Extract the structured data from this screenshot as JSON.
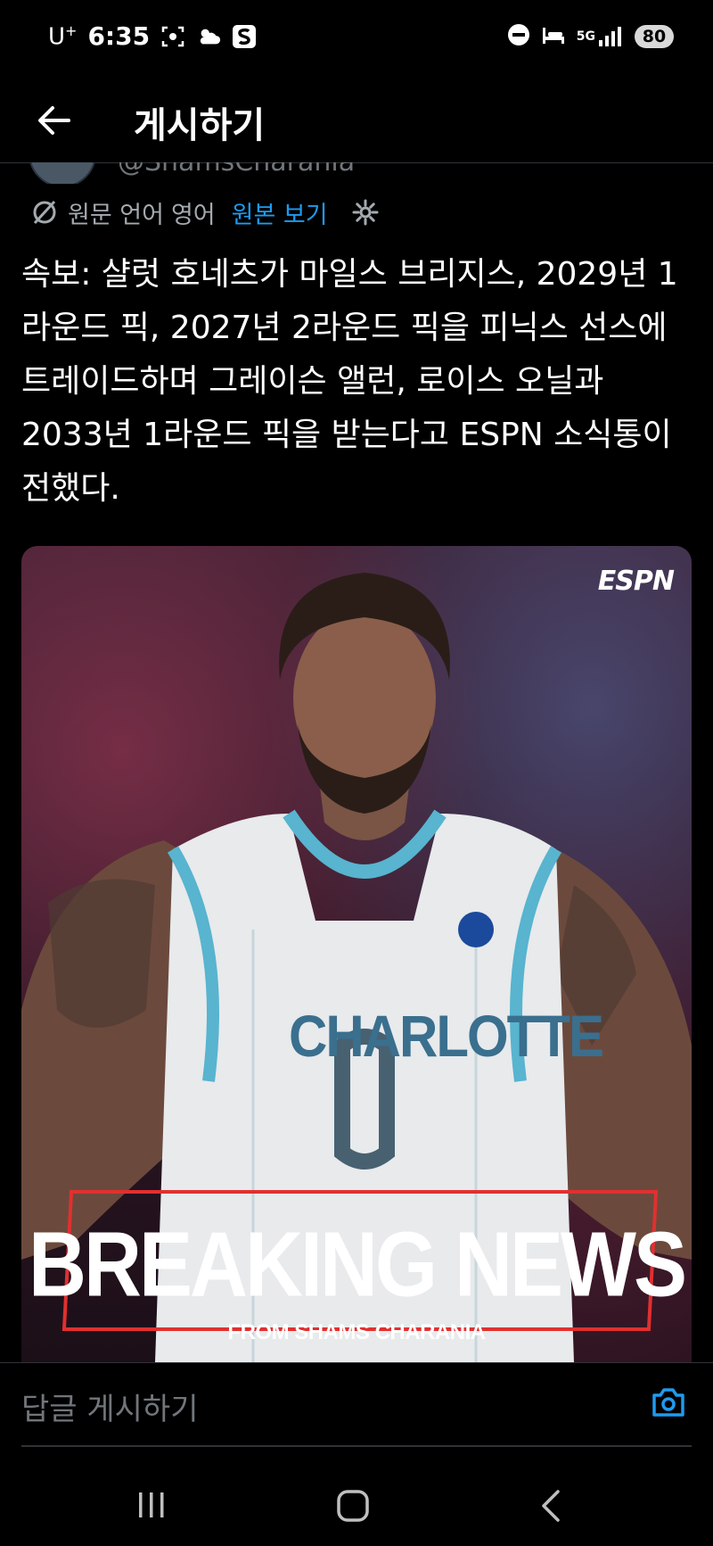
{
  "status_bar": {
    "carrier": "U",
    "carrier_sup": "+",
    "time": "6:35",
    "network": "5G",
    "battery": "80"
  },
  "header": {
    "title": "게시하기"
  },
  "tweet": {
    "handle": "@ShamsCharania",
    "translation_label": "원문 언어",
    "translation_lang": "영어",
    "show_original": "원본 보기",
    "text": "속보: 샬럿 호네츠가 마일스 브리지스, 2029년 1라운드 픽, 2027년 2라운드 픽을 피닉스 선스에 트레이드하며 그레이슨 앨런, 로이스 오닐과 2033년 1라운드 픽을 받는다고 ESPN 소식통이 전했다."
  },
  "media": {
    "logo": "ESPN",
    "jersey_text": "CHARLOTTE",
    "banner_title": "BREAKING NEWS",
    "banner_sub": "FROM SHAMS CHARANIA"
  },
  "reply": {
    "placeholder": "답글 게시하기"
  },
  "colors": {
    "accent": "#1d9bf0",
    "background": "#000000",
    "muted": "#71767b",
    "breaking_red": "#e13030"
  }
}
